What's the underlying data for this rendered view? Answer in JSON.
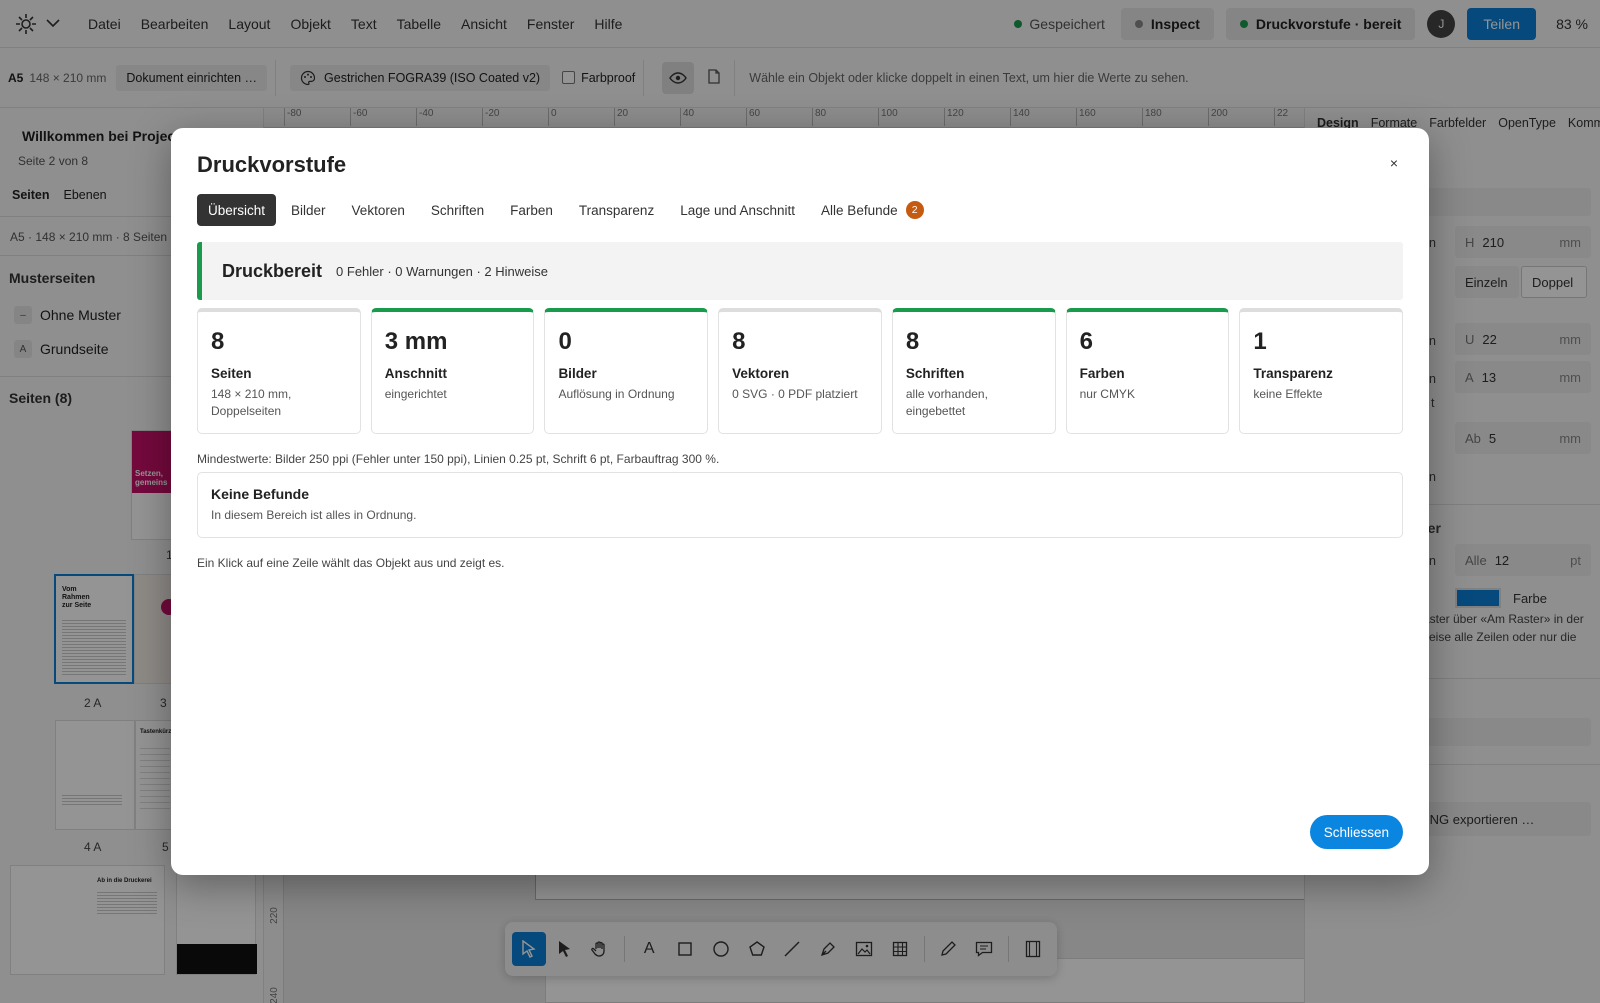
{
  "menubar": {
    "menu": [
      "Datei",
      "Bearbeiten",
      "Layout",
      "Objekt",
      "Text",
      "Tabelle",
      "Ansicht",
      "Fenster",
      "Hilfe"
    ],
    "saved": "Gespeichert",
    "inspect": "Inspect",
    "preflight": "Druckvorstufe · bereit",
    "avatar": "J",
    "share": "Teilen",
    "zoom": "83 %"
  },
  "toolbar": {
    "format": "A5",
    "size": "148 × 210 mm",
    "setup": "Dokument einrichten …",
    "profile": "Gestrichen FOGRA39 (ISO Coated v2)",
    "softproof": "Farbproof",
    "hint": "Wähle ein Objekt oder klicke doppelt in einen Text, um hier die Werte zu sehen."
  },
  "leftpanel": {
    "title": "Willkommen bei Projec",
    "subtitle": "Seite 2 von 8",
    "tabs": [
      "Seiten",
      "Ebenen"
    ],
    "info": "A5 · 148 × 210 mm · 8 Seiten ·",
    "masters_heading": "Musterseiten",
    "masters": [
      {
        "badge": "–",
        "name": "Ohne Muster"
      },
      {
        "badge": "A",
        "name": "Grundseite"
      }
    ],
    "pages_heading": "Seiten (8)",
    "thumb_labels": [
      "1",
      "2 A",
      "3",
      "4 A",
      "5"
    ],
    "thumb_text": {
      "t1": "Setzen, gemeins",
      "t2": "Vom Rahmen zur Seite",
      "t4": "Tastenkürz",
      "t6": "Ab in die Druckerei"
    }
  },
  "ruler": {
    "top": [
      "-80",
      "-60",
      "-40",
      "-20",
      "0",
      "20",
      "40",
      "60",
      "80",
      "100",
      "120",
      "140",
      "160",
      "180",
      "200",
      "22"
    ],
    "left": [
      "220",
      "240"
    ]
  },
  "rightpanel": {
    "tabs": [
      "Design",
      "Formate",
      "Farbfelder",
      "OpenType",
      "Komme"
    ],
    "h_label": "H",
    "h_value": "210",
    "unit": "mm",
    "single": "Einzeln",
    "double": "Doppel",
    "u_label": "U",
    "u_value": "22",
    "a_label": "A",
    "a_value": "13",
    "ab_label": "Ab",
    "ab_value": "5",
    "frag_n1": "n",
    "frag_n2": "n",
    "frag_n3": "n",
    "frag_t": "t",
    "frag_n4": "n",
    "grid_heading": "ter",
    "frag_n5": "n",
    "all_label": "Alle",
    "all_value": "12",
    "all_unit": "pt",
    "color_label": "Farbe",
    "color_swatch": "#0b7fd6",
    "help_line1": "aster über «Am Raster» in der",
    "help_line2": "veise alle Zeilen oder nur die",
    "export": "PNG exportieren …"
  },
  "modal": {
    "title": "Druckvorstufe",
    "close": "×",
    "tabs": [
      "Übersicht",
      "Bilder",
      "Vektoren",
      "Schriften",
      "Farben",
      "Transparenz",
      "Lage und Anschnitt"
    ],
    "tab_all": "Alle Befunde",
    "tab_all_count": "2",
    "status_title": "Druckbereit",
    "status_detail": "0 Fehler · 0 Warnungen · 2 Hinweise",
    "status_color": "#1a9a4d",
    "cards": [
      {
        "value": "8",
        "label": "Seiten",
        "desc": "148 × 210 mm, Doppelseiten",
        "ok": false
      },
      {
        "value": "3 mm",
        "label": "Anschnitt",
        "desc": "eingerichtet",
        "ok": true
      },
      {
        "value": "0",
        "label": "Bilder",
        "desc": "Auflösung in Ordnung",
        "ok": true
      },
      {
        "value": "8",
        "label": "Vektoren",
        "desc": "0 SVG · 0 PDF platziert",
        "ok": false
      },
      {
        "value": "8",
        "label": "Schriften",
        "desc": "alle vorhanden, eingebettet",
        "ok": true
      },
      {
        "value": "6",
        "label": "Farben",
        "desc": "nur CMYK",
        "ok": true
      },
      {
        "value": "1",
        "label": "Transparenz",
        "desc": "keine Effekte",
        "ok": false
      }
    ],
    "minimums": "Mindestwerte: Bilder 250 ppi (Fehler unter 150 ppi), Linien 0.25 pt, Schrift 6 pt, Farbauftrag 300 %.",
    "nofind_title": "Keine Befunde",
    "nofind_desc": "In diesem Bereich ist alles in Ordnung.",
    "hint": "Ein Klick auf eine Zeile wählt das Objekt aus und zeigt es.",
    "close_button": "Schliessen"
  },
  "dock": {
    "tools": [
      "select-tool",
      "direct-select-tool",
      "hand-tool",
      "text-tool",
      "rectangle-tool",
      "ellipse-tool",
      "polygon-tool",
      "line-tool",
      "pen-tool",
      "image-tool",
      "table-tool",
      "pencil-tool",
      "comment-tool",
      "panel-toggle"
    ],
    "text_tool_glyph": "A"
  }
}
